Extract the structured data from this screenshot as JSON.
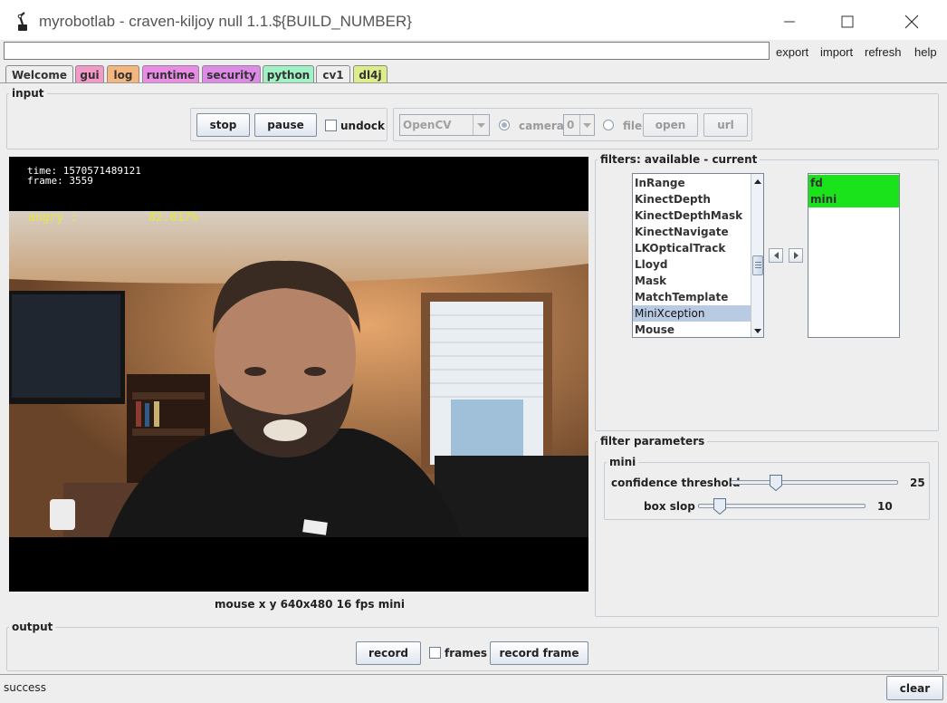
{
  "window": {
    "title": "myrobotlab - craven-kiljoy null 1.1.${BUILD_NUMBER}"
  },
  "topbar": {
    "command_value": "",
    "menu": [
      "export",
      "import",
      "refresh",
      "help"
    ]
  },
  "tabs": [
    {
      "label": "Welcome",
      "color": "#eeeeee",
      "active": false
    },
    {
      "label": "gui",
      "color": "#f299c7",
      "active": false
    },
    {
      "label": "log",
      "color": "#f5b67e",
      "active": false
    },
    {
      "label": "runtime",
      "color": "#ea8be6",
      "active": false
    },
    {
      "label": "security",
      "color": "#df8ae8",
      "active": false
    },
    {
      "label": "python",
      "color": "#9ef2c4",
      "active": false
    },
    {
      "label": "cv1",
      "color": "#eeeeee",
      "active": true
    },
    {
      "label": "dl4j",
      "color": "#dbee8a",
      "active": false
    }
  ],
  "input_panel": {
    "title": "input",
    "stop_label": "stop",
    "pause_label": "pause",
    "undock_label": "undock",
    "grabber_value": "OpenCV",
    "camera_label": "camera",
    "camera_index": "0",
    "file_label": "file",
    "open_label": "open",
    "url_label": "url"
  },
  "video": {
    "time_text": "time: 1570571489121",
    "frame_text": "frame: 3559",
    "emotion_text": "angry :          82.017%",
    "status_line": "mouse x y  640x480  16 fps  mini"
  },
  "filters": {
    "title": "filters: available - current",
    "available": [
      "InRange",
      "KinectDepth",
      "KinectDepthMask",
      "KinectNavigate",
      "LKOpticalTrack",
      "Lloyd",
      "Mask",
      "MatchTemplate",
      "MiniXception",
      "Mouse"
    ],
    "selected_index": 8,
    "current": [
      "fd",
      "mini"
    ]
  },
  "filter_parameters": {
    "title": "filter parameters",
    "group_title": "mini",
    "confidence_label": "confidence threshold",
    "confidence_value": "25",
    "confidence_fraction": 0.25,
    "box_slop_label": "box slop",
    "box_slop_value": "10",
    "box_slop_fraction": 0.1
  },
  "output_panel": {
    "title": "output",
    "record_label": "record",
    "frames_label": "frames",
    "record_frame_label": "record frame"
  },
  "status": {
    "text": "success",
    "clear_label": "clear"
  },
  "icons": {
    "app": "robot-arm-icon",
    "minimize": "minimize-icon",
    "maximize": "maximize-icon",
    "close": "close-icon"
  }
}
